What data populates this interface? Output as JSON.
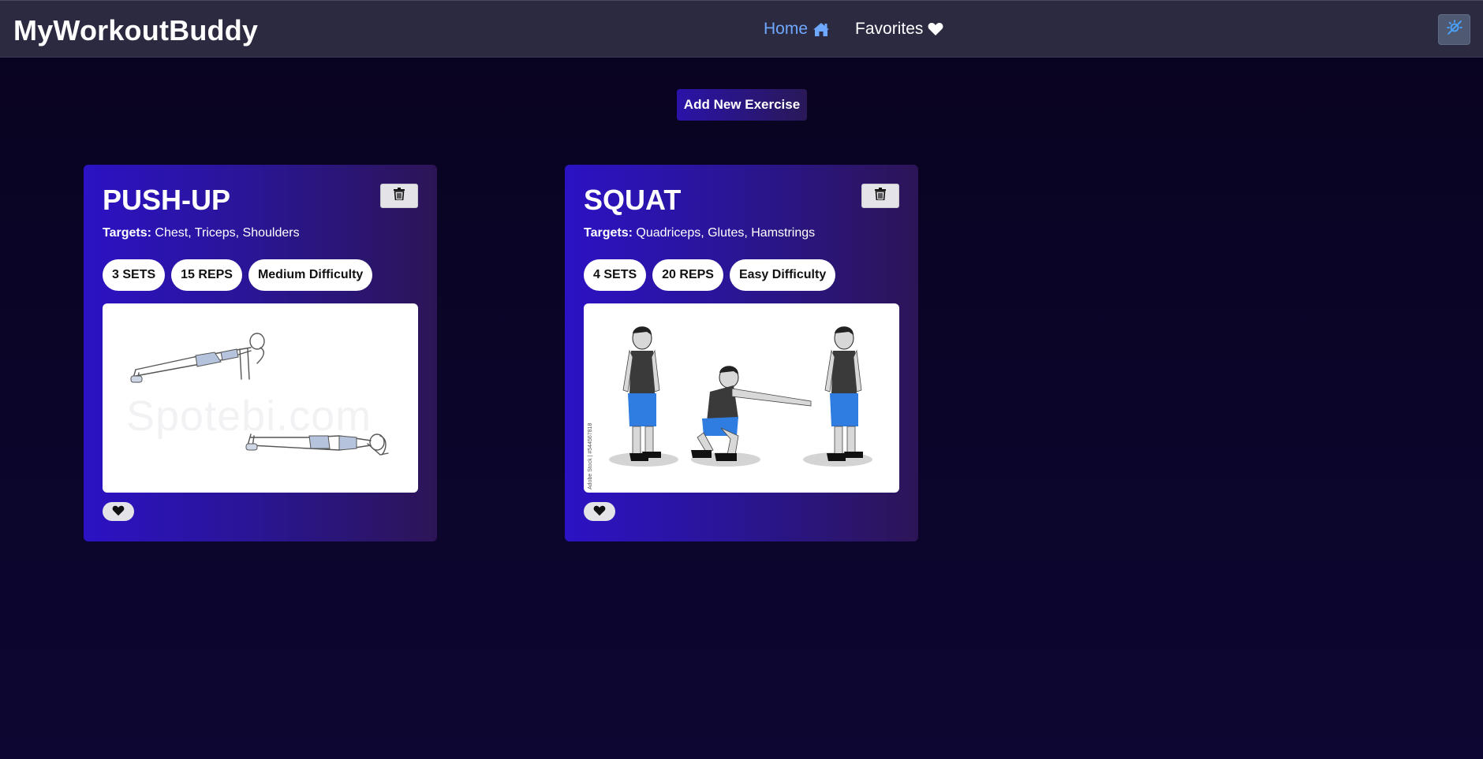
{
  "header": {
    "brand": "MyWorkoutBuddy",
    "nav": [
      {
        "label": "Home",
        "icon": "home-icon",
        "active": true
      },
      {
        "label": "Favorites",
        "icon": "heart-icon",
        "active": false
      }
    ],
    "theme_toggle_icon": "theme-toggle-icon"
  },
  "actions": {
    "add_label": "Add New Exercise"
  },
  "exercises": [
    {
      "title": "PUSH-UP",
      "targets_label": "Targets:",
      "targets": "Chest, Triceps, Shoulders",
      "sets": "3 SETS",
      "reps": "15 REPS",
      "difficulty": "Medium Difficulty",
      "image_watermark": "Spotebi.com"
    },
    {
      "title": "SQUAT",
      "targets_label": "Targets:",
      "targets": "Quadriceps, Glutes, Hamstrings",
      "sets": "4 SETS",
      "reps": "20 REPS",
      "difficulty": "Easy Difficulty",
      "image_credit": "Adobe Stock | #544567818"
    }
  ],
  "colors": {
    "background": "#0b0528",
    "navbar": "#2c2a40",
    "nav_active": "#6fa8ff",
    "card_gradient_start": "#2b12c4",
    "card_gradient_end": "#2c1556"
  }
}
